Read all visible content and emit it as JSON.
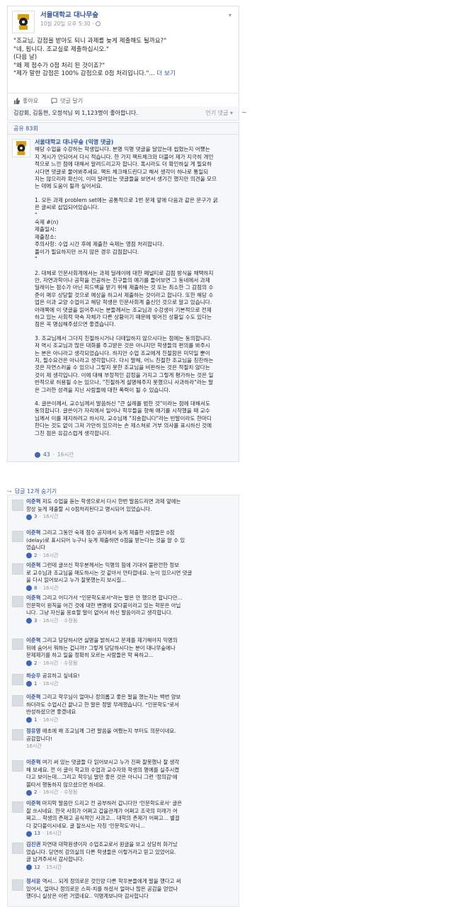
{
  "post": {
    "page_name": "서울대학교 대나무숲",
    "timestamp": "10월 20일 오후 5:30 ·",
    "body_lines": [
      "\"조교님, 감점을 받아도 되니 과제를 늦게 제출해도 될까요?\"",
      "\"네, 됩니다. 조교실로 제출하십시오.\"",
      "(다음 날)",
      "\"왜 제 점수가 0점 처리 된 것이죠?\"",
      "\"제가 말한 감점은 100% 감점으로 0점 처리입니다.\"..."
    ],
    "see_more": "더 보기",
    "like_label": "좋아요",
    "comment_label": "댓글 달기"
  },
  "likes": {
    "text": "김강회, 김동현, 오정석님 외 1,123명이 좋아합니다.",
    "sort_label": "인기 댓글 ▾"
  },
  "shares": {
    "text": "공유 83회"
  },
  "anon_comment": {
    "author": "서울대학교 대나무숲 (익명 댓글)",
    "intro_lines": [
      "해당 수업을 수강하는 학생입니다. 분명 익명 댓글을 달았는데 씹혔는지 어쨌는",
      "지 게시가 안되어서 다시 적습니다. 한 가지 팩트체크와 더불어 제가 지극히 개인",
      "적으로 느낀 점에 대해서 알려드리고자 합니다. 혹시라도 더 확인하실 게 필요하",
      "시다면 댓글로 물어봐주세요. 팩트 체크해드린다고 해서 생각이 하나로 통일되",
      "지는 않으리라 확신이, 이미 달려있는 댓글들을 보면서 생기긴 했지만 의견을 모으",
      "는 데에 도움이 될까 싶어서요."
    ],
    "p1_lines": [
      "1. 모든 과제 problem set에는 공통적으로 1번 문제 앞에 다음과 같은 문구가 굵",
      "은 글씨로 삽입되어있습니다.",
      "\"",
      "숙제 #(n)",
      "제출일시:",
      "제출장소:",
      "주의사항: 수업 시간 후에 제출한 숙제는 영점 처리합니다.",
      "풀이가 필요하지만 쓰지 않은 경우 감점합니다.",
      "\""
    ],
    "p2_lines": [
      "2. 대체로 인문사회계에서는 과제 딜레이에 대한 페널티로 감점 방식을 채택하지",
      "만, 자연과학이나 공학을 전공하는 친구들의 얘기를 들어보면 그 동네에서 과제",
      "딜레이는 점수가 아닌 피드백을 받기 위해 제출하는 것 또는 최소한 그 감점의 수",
      "준이 매우 상당할 것으로 예상을 하고서 제출하는 것이라고 합니다. 또한 해당 수",
      "업은 이과 교양 수업이고 해당 학생은 인문사회계 출신인 것으로 알고 있습니다.",
      "아래쪽에 이 댓글을 읽어주시는 분들께서는 조교님과 수강생이 기본적으로 전제",
      "하고 있는 사회적 약속 자체가 다른 상황이기 때문에 빚어진 상황일 수도 있다는",
      "점은 꼭 명심해주셨으면 좋겠습니다."
    ],
    "p3_lines": [
      "3. 조교님께서 그다지 친절하시거나 디테일하지 않으시다는 점에는 동의합니다.",
      "저 역시 조교님과 많은 대화를 주고받은 것은 아니지만 학생들의 편의를 봐주시",
      "는 분은 아니라고 생각되었습니다. 하지만 수업 조교에게 친절함은 미덕일 뿐이",
      "지, 필수요건은 아니라고 생각합니다. 다시 말해, 어느 친절한 조교님을 칭찬하는",
      "것은 자연스러울 수 있으나 그렇지 못한 조교님을 비판하는 것은 적절치 않다는",
      "것이 제 생각입니다. 이에 대해 부정적인 감정을 가지고 그렇게 평가하는 것은 일",
      "반적으로 허용될 수는 있으나, \"친절하게 설명해주지 못했으니 사과하라\"라는 말",
      "은 그러한 성격을 지닌 사람들에 대한 폭력이 될 수 있습니다."
    ],
    "p4_lines": [
      "4. 글쓴이께서, 교수님께서 말씀하신 \"큰 실례를 범한 것\"이라는 점에 대해서도",
      "동의합니다. 글쓴이가 자리에서 일어나 학우들을 향해 얘기를 시작했을 때 교수",
      "님께서 이를 제지하려고 하시자, 교수님께 \"죄송합니다\"라는 빈말이라도 한마디",
      "한다는 것도 없이 그저 가만히 있으라는 손 제스쳐로 거부 의사를 표시하신 것에",
      "그친 점은 유감스럽게 생각합니다."
    ],
    "like_count": "43",
    "time": "16시간"
  },
  "replies_toggle": "답글 12개 숨기기",
  "replies": [
    {
      "name": "이준혁",
      "lines": [
        "저도 수업을 듣는 학생으로서 다시 한번 말씀드리면 과제 앞에는",
        "항상 늦게 제출할 시 0점처리된다고 명시되어 있었습니다."
      ],
      "likes": "3",
      "time": "16시간",
      "edited": ""
    },
    {
      "name": "이준혁",
      "lines": [
        "그리고 그동안 숙제 점수 공지에서 늦게 제출한 사람들은 0점",
        "(delay)로 표시되어 누구나 늦게 제출하면 0점을 받는다는 것을 알 수 있",
        "었습니다"
      ],
      "likes": "2",
      "time": "16시간",
      "edited": ""
    },
    {
      "name": "이준혁",
      "lines": [
        "그런데 글쓰신 학우분께서는 익명의 힘에 기대어 불완전한 정보",
        "로 교수님과 조교님을 매도하시는 것 같아서 안타깝네요. 눈이 있으시면 댓글",
        "을 다시 읽어보시고 누가 잘못했는지 보시길..."
      ],
      "likes": "8",
      "time": "16시간",
      "edited": ""
    },
    {
      "name": "이준혁",
      "lines": [
        "그리고 어디가서 \"인문학도로서\"라는 말은 안 했으면 합니다만...",
        "인문학이 원칙을 어긴 것에 대한 변명에 갖다붙이라고 있는 학문은 아닙",
        "니다. 그냥 자신을 옹호할 말이 없어서 하신 말씀이라고 생각합니다."
      ],
      "likes": "3",
      "time": "16시간",
      "edited": "· 수정됨"
    },
    {
      "name": "이준혁",
      "lines": [
        "그리고 당당하시면 실명을 밝히시고 문제를 제기해야지 익명의",
        "뒤에 숨어서 뭐하는 겁니까? 그렇게 당당하시다는 분이 대나무숲에나",
        "문제제기를 하고 일을 정확히 모르는 사람들은 막 욕하고..."
      ],
      "likes": "2",
      "time": "16시간",
      "edited": "· 수정됨"
    },
    {
      "name": "하승우",
      "lines": [
        "공유하고 싶네요!"
      ],
      "likes": "1",
      "time": "16시간",
      "edited": ""
    },
    {
      "name": "이준혁",
      "lines": [
        "그리고 학우님이 얼마나 정의롭고 좋은 말을 했는지는 백번 양보",
        "하더라도 수업시간 끝나고 한 말은 정말 무례했습니다. \"인문학도\"로서",
        "반성하셨으면 좋겠네요"
      ],
      "likes": "1",
      "time": "16시간",
      "edited": ""
    },
    {
      "name": "정유영",
      "lines": [
        "애초에 왜 조교님께 그런 말씀을 여쭸는지 부터도 의문이네요.",
        "공감합니다!"
      ],
      "likes": "",
      "time": "16시간",
      "edited": ""
    },
    {
      "name": "이준혁",
      "lines": [
        "여기 써 있는 댓글들 다 읽어보시고 누가 진짜 잘못했나 잘 생각",
        "해 보세요. 전 이 글이 학교와 수업과 교수자와 학생의 명예를 실추시켰",
        "다고 보이는데...그리고 학우님 말만 좋은 것은 아니니 그런 '정의감'에",
        "불타서 행동하지 않으셨으면 하네요."
      ],
      "likes": "2",
      "time": "16시간",
      "edited": "· 수정됨"
    },
    {
      "name": "이준혁",
      "lines": [
        "마지막 말씀만 드리고 전 공부하러 갑니다만 '인문학도로서' 글은",
        "잘 쓰시네요. 한국 사회가 어쩌고 갑을관계가 어쩌고 조국의 미래가 어",
        "쩌고... 학생의 존재고 공식적인 사과고... 대학의 존재가 어쩌고... 별걸",
        "다 갖다붙이시네요. 글 잘쓰시는 자칭 '인문학도'라니..."
      ],
      "likes": "13",
      "time": "16시간",
      "edited": ""
    },
    {
      "name": "김진권",
      "lines": [
        "자연대 대학원생이자 수업조교로서 원글을 보고 상당히 화가났",
        "었습니다. 당연히 강의실의 다른 학생들은 이렇거라고 믿고 있었어요.",
        "글 남겨주셔서 감사합니다."
      ],
      "likes": "12",
      "time": "15시간",
      "edited": ""
    },
    {
      "name": "정서윤",
      "lines": [
        "역시... 되게 정의로운 것인양 다른 학우분들에게 말을 했다고 써",
        "있어서, 얼마나 정의로운 스피-치를 하셨서 얼마나 많은 공감을 얻었나",
        "했더니 실상은 이런 거였네요.. 익명계보나마 감사합니다"
      ],
      "likes": "",
      "time": "",
      "edited": ""
    }
  ]
}
